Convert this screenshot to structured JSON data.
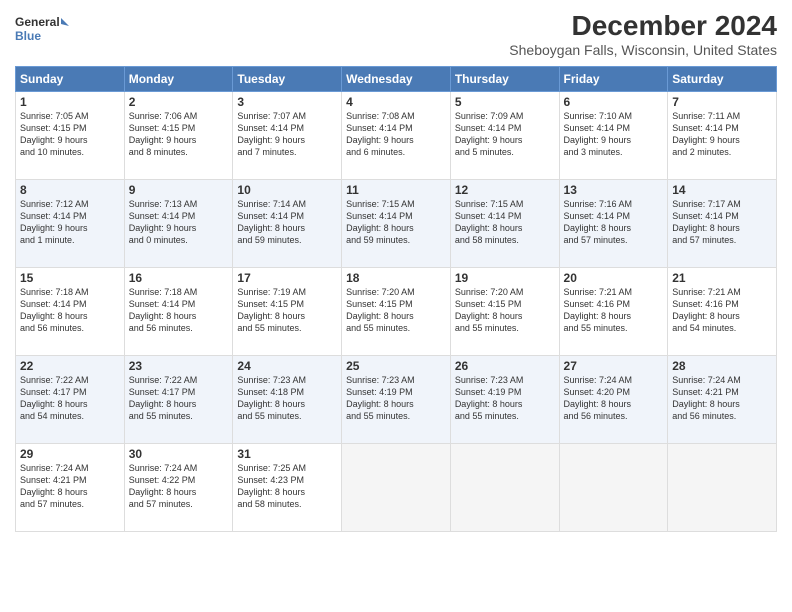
{
  "header": {
    "logo_line1": "General",
    "logo_line2": "Blue",
    "main_title": "December 2024",
    "subtitle": "Sheboygan Falls, Wisconsin, United States"
  },
  "days_of_week": [
    "Sunday",
    "Monday",
    "Tuesday",
    "Wednesday",
    "Thursday",
    "Friday",
    "Saturday"
  ],
  "weeks": [
    [
      {
        "day": "1",
        "sunrise": "7:05 AM",
        "sunset": "4:15 PM",
        "daylight": "9 hours and 10 minutes."
      },
      {
        "day": "2",
        "sunrise": "7:06 AM",
        "sunset": "4:15 PM",
        "daylight": "9 hours and 8 minutes."
      },
      {
        "day": "3",
        "sunrise": "7:07 AM",
        "sunset": "4:14 PM",
        "daylight": "9 hours and 7 minutes."
      },
      {
        "day": "4",
        "sunrise": "7:08 AM",
        "sunset": "4:14 PM",
        "daylight": "9 hours and 6 minutes."
      },
      {
        "day": "5",
        "sunrise": "7:09 AM",
        "sunset": "4:14 PM",
        "daylight": "9 hours and 5 minutes."
      },
      {
        "day": "6",
        "sunrise": "7:10 AM",
        "sunset": "4:14 PM",
        "daylight": "9 hours and 3 minutes."
      },
      {
        "day": "7",
        "sunrise": "7:11 AM",
        "sunset": "4:14 PM",
        "daylight": "9 hours and 2 minutes."
      }
    ],
    [
      {
        "day": "8",
        "sunrise": "7:12 AM",
        "sunset": "4:14 PM",
        "daylight": "9 hours and 1 minute."
      },
      {
        "day": "9",
        "sunrise": "7:13 AM",
        "sunset": "4:14 PM",
        "daylight": "9 hours and 0 minutes."
      },
      {
        "day": "10",
        "sunrise": "7:14 AM",
        "sunset": "4:14 PM",
        "daylight": "8 hours and 59 minutes."
      },
      {
        "day": "11",
        "sunrise": "7:15 AM",
        "sunset": "4:14 PM",
        "daylight": "8 hours and 59 minutes."
      },
      {
        "day": "12",
        "sunrise": "7:15 AM",
        "sunset": "4:14 PM",
        "daylight": "8 hours and 58 minutes."
      },
      {
        "day": "13",
        "sunrise": "7:16 AM",
        "sunset": "4:14 PM",
        "daylight": "8 hours and 57 minutes."
      },
      {
        "day": "14",
        "sunrise": "7:17 AM",
        "sunset": "4:14 PM",
        "daylight": "8 hours and 57 minutes."
      }
    ],
    [
      {
        "day": "15",
        "sunrise": "7:18 AM",
        "sunset": "4:14 PM",
        "daylight": "8 hours and 56 minutes."
      },
      {
        "day": "16",
        "sunrise": "7:18 AM",
        "sunset": "4:14 PM",
        "daylight": "8 hours and 56 minutes."
      },
      {
        "day": "17",
        "sunrise": "7:19 AM",
        "sunset": "4:15 PM",
        "daylight": "8 hours and 55 minutes."
      },
      {
        "day": "18",
        "sunrise": "7:20 AM",
        "sunset": "4:15 PM",
        "daylight": "8 hours and 55 minutes."
      },
      {
        "day": "19",
        "sunrise": "7:20 AM",
        "sunset": "4:15 PM",
        "daylight": "8 hours and 55 minutes."
      },
      {
        "day": "20",
        "sunrise": "7:21 AM",
        "sunset": "4:16 PM",
        "daylight": "8 hours and 55 minutes."
      },
      {
        "day": "21",
        "sunrise": "7:21 AM",
        "sunset": "4:16 PM",
        "daylight": "8 hours and 54 minutes."
      }
    ],
    [
      {
        "day": "22",
        "sunrise": "7:22 AM",
        "sunset": "4:17 PM",
        "daylight": "8 hours and 54 minutes."
      },
      {
        "day": "23",
        "sunrise": "7:22 AM",
        "sunset": "4:17 PM",
        "daylight": "8 hours and 55 minutes."
      },
      {
        "day": "24",
        "sunrise": "7:23 AM",
        "sunset": "4:18 PM",
        "daylight": "8 hours and 55 minutes."
      },
      {
        "day": "25",
        "sunrise": "7:23 AM",
        "sunset": "4:19 PM",
        "daylight": "8 hours and 55 minutes."
      },
      {
        "day": "26",
        "sunrise": "7:23 AM",
        "sunset": "4:19 PM",
        "daylight": "8 hours and 55 minutes."
      },
      {
        "day": "27",
        "sunrise": "7:24 AM",
        "sunset": "4:20 PM",
        "daylight": "8 hours and 56 minutes."
      },
      {
        "day": "28",
        "sunrise": "7:24 AM",
        "sunset": "4:21 PM",
        "daylight": "8 hours and 56 minutes."
      }
    ],
    [
      {
        "day": "29",
        "sunrise": "7:24 AM",
        "sunset": "4:21 PM",
        "daylight": "8 hours and 57 minutes."
      },
      {
        "day": "30",
        "sunrise": "7:24 AM",
        "sunset": "4:22 PM",
        "daylight": "8 hours and 57 minutes."
      },
      {
        "day": "31",
        "sunrise": "7:25 AM",
        "sunset": "4:23 PM",
        "daylight": "8 hours and 58 minutes."
      },
      null,
      null,
      null,
      null
    ]
  ]
}
